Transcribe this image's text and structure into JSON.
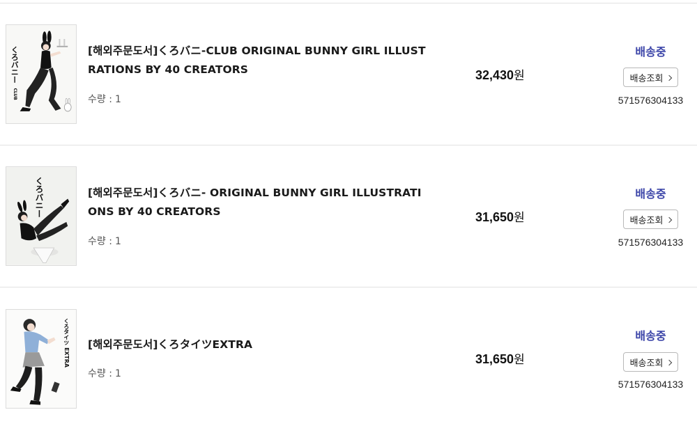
{
  "orders": [
    {
      "title": "[해외주문도서]くろバニ-CLUB ORIGINAL BUNNY GIRL ILLUSTRATIONS BY 40 CREATORS",
      "qty_label": "수량 :",
      "qty": "1",
      "price": "32,430",
      "price_unit": "원",
      "status": "배송중",
      "track_label": "배송조회",
      "tracking_no": "571576304133",
      "cover_text": "くろバニー",
      "cover_sub": "CLUB"
    },
    {
      "title": "[해외주문도서]くろバニ- ORIGINAL BUNNY GIRL ILLUSTRATIONS BY 40 CREATORS",
      "qty_label": "수량 :",
      "qty": "1",
      "price": "31,650",
      "price_unit": "원",
      "status": "배송중",
      "track_label": "배송조회",
      "tracking_no": "571576304133",
      "cover_text": "くろバニー"
    },
    {
      "title": "[해외주문도서]くろタイツEXTRA",
      "qty_label": "수량 :",
      "qty": "1",
      "price": "31,650",
      "price_unit": "원",
      "status": "배송중",
      "track_label": "배송조회",
      "tracking_no": "571576304133",
      "cover_text": "くろタイツ EXTRA"
    }
  ],
  "colors": {
    "status": "#3b44a8",
    "divider": "#e2e2e2",
    "text": "#1a1a1a"
  }
}
